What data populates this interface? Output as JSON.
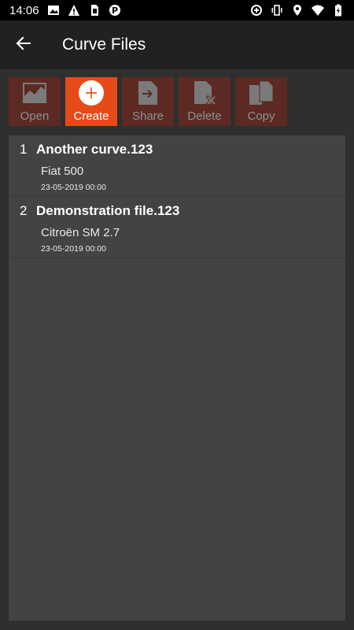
{
  "status_bar": {
    "time": "14:06",
    "icons_left": [
      "image-icon",
      "warning-icon",
      "sim-card-icon",
      "parking-icon"
    ],
    "icons_right": [
      "data-saver-icon",
      "vibrate-icon",
      "location-icon",
      "wifi-icon",
      "battery-charging-icon"
    ]
  },
  "app_bar": {
    "title": "Curve Files",
    "back_icon": "arrow-back-icon"
  },
  "toolbar": {
    "buttons": [
      {
        "label": "Open",
        "icon": "chart-icon",
        "enabled": false
      },
      {
        "label": "Create",
        "icon": "add-circle-icon",
        "enabled": true
      },
      {
        "label": "Share",
        "icon": "file-share-icon",
        "enabled": false
      },
      {
        "label": "Delete",
        "icon": "file-delete-icon",
        "enabled": false
      },
      {
        "label": "Copy",
        "icon": "copy-files-icon",
        "enabled": false
      }
    ],
    "active_color": "#e64a19",
    "disabled_color": "#5c2a22"
  },
  "files": [
    {
      "index": "1",
      "name": "Another curve.123",
      "vehicle": "Fiat 500",
      "date": "23-05-2019 00:00"
    },
    {
      "index": "2",
      "name": "Demonstration file.123",
      "vehicle": "Citroën SM 2.7",
      "date": "23-05-2019 00:00"
    }
  ]
}
